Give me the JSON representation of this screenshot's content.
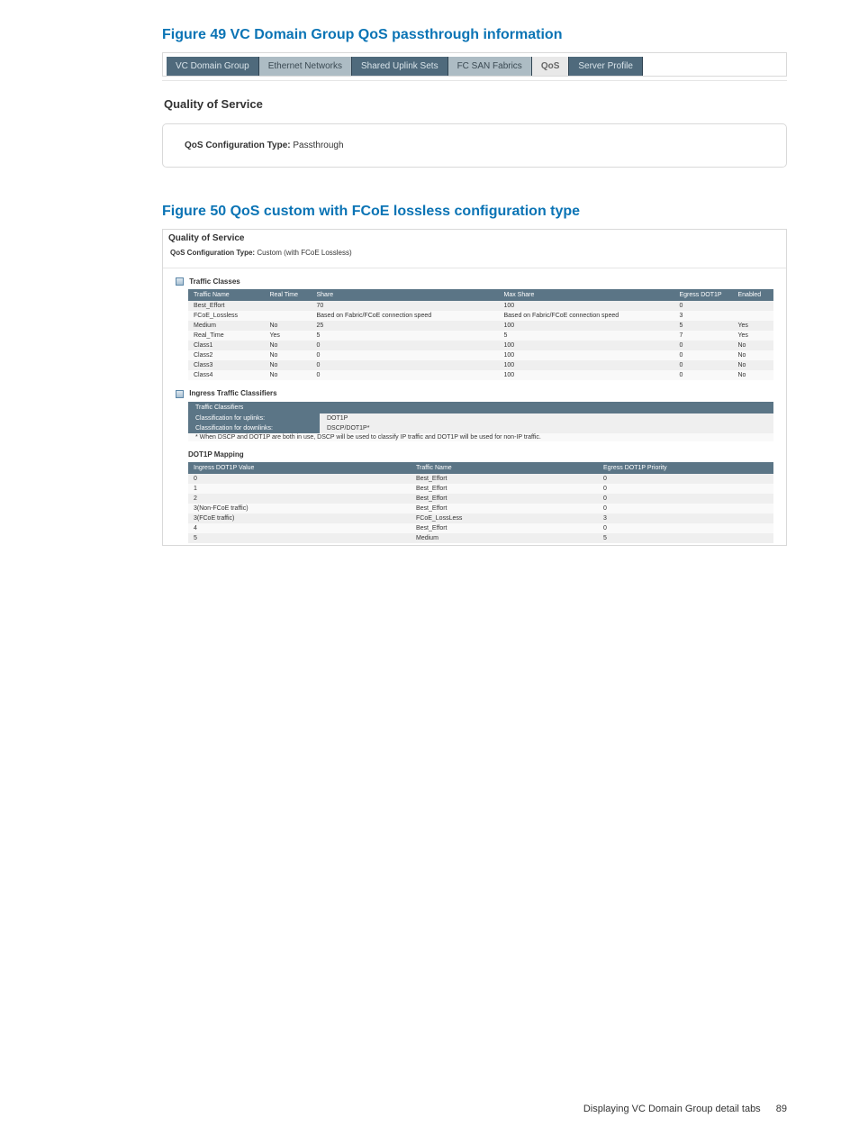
{
  "fig49": {
    "title": "Figure 49 VC Domain Group QoS passthrough information",
    "tabs": [
      {
        "label": "VC Domain Group",
        "kind": "dark"
      },
      {
        "label": "Ethernet Networks",
        "kind": "light"
      },
      {
        "label": "Shared Uplink Sets",
        "kind": "dark"
      },
      {
        "label": "FC SAN Fabrics",
        "kind": "light"
      },
      {
        "label": "QoS",
        "kind": "active"
      },
      {
        "label": "Server Profile",
        "kind": "dark"
      }
    ],
    "heading": "Quality of Service",
    "cfg_label": "QoS Configuration Type:",
    "cfg_value": "Passthrough"
  },
  "fig50": {
    "title": "Figure 50 QoS custom with FCoE lossless configuration type",
    "heading": "Quality of Service",
    "cfg_label": "QoS Configuration Type:",
    "cfg_value": "Custom (with FCoE Lossless)",
    "traffic_classes": {
      "section": "Traffic Classes",
      "cols": [
        "Traffic Name",
        "Real Time",
        "Share",
        "Max Share",
        "Egress DOT1P",
        "Enabled"
      ],
      "rows": [
        {
          "name": "Best_Effort",
          "rt": "",
          "share": "70",
          "max": "100",
          "egress": "0",
          "enabled": ""
        },
        {
          "name": "FCoE_Lossless",
          "rt": "",
          "share": "Based on Fabric/FCoE connection speed",
          "max": "Based on Fabric/FCoE connection speed",
          "egress": "3",
          "enabled": ""
        },
        {
          "name": "Medium",
          "rt": "No",
          "share": "25",
          "max": "100",
          "egress": "5",
          "enabled": "Yes"
        },
        {
          "name": "Real_Time",
          "rt": "Yes",
          "share": "5",
          "max": "5",
          "egress": "7",
          "enabled": "Yes"
        },
        {
          "name": "Class1",
          "rt": "No",
          "share": "0",
          "max": "100",
          "egress": "0",
          "enabled": "No"
        },
        {
          "name": "Class2",
          "rt": "No",
          "share": "0",
          "max": "100",
          "egress": "0",
          "enabled": "No"
        },
        {
          "name": "Class3",
          "rt": "No",
          "share": "0",
          "max": "100",
          "egress": "0",
          "enabled": "No"
        },
        {
          "name": "Class4",
          "rt": "No",
          "share": "0",
          "max": "100",
          "egress": "0",
          "enabled": "No"
        }
      ]
    },
    "ingress": {
      "section": "Ingress Traffic Classifiers",
      "header": "Traffic Classifiers",
      "uplinks_label": "Classification for uplinks:",
      "uplinks_value": "DOT1P",
      "downlinks_label": "Classification for downlinks:",
      "downlinks_value": "DSCP/DOT1P*",
      "note": "* When DSCP and DOT1P are both in use, DSCP will be used to classify IP traffic and DOT1P will be used for non-IP traffic.",
      "mapping_title": "DOT1P Mapping",
      "map_cols": [
        "Ingress DOT1P Value",
        "Traffic Name",
        "Egress DOT1P Priority"
      ],
      "map_rows": [
        {
          "v": "0",
          "t": "Best_Effort",
          "p": "0"
        },
        {
          "v": "1",
          "t": "Best_Effort",
          "p": "0"
        },
        {
          "v": "2",
          "t": "Best_Effort",
          "p": "0"
        },
        {
          "v": "3(Non-FCoE traffic)",
          "t": "Best_Effort",
          "p": "0"
        },
        {
          "v": "3(FCoE traffic)",
          "t": "FCoE_LossLess",
          "p": "3"
        },
        {
          "v": "4",
          "t": "Best_Effort",
          "p": "0"
        },
        {
          "v": "5",
          "t": "Medium",
          "p": "5"
        }
      ]
    }
  },
  "footer": {
    "section": "Displaying VC Domain Group detail tabs",
    "page": "89"
  }
}
